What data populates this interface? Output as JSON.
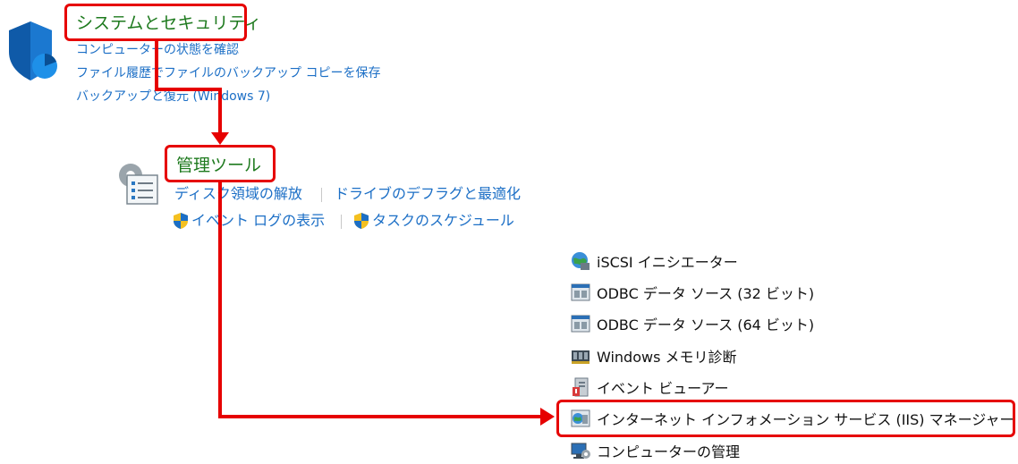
{
  "system_security": {
    "heading": "システムとセキュリティ",
    "links": [
      "コンピューターの状態を確認",
      "ファイル履歴でファイルのバックアップ コピーを保存",
      "バックアップと復元 (Windows 7)"
    ]
  },
  "admin_tools": {
    "heading": "管理ツール",
    "row1": [
      "ディスク領域の解放",
      "ドライブのデフラグと最適化"
    ],
    "row2": [
      "イベント ログの表示",
      "タスクのスケジュール"
    ]
  },
  "tool_list": [
    {
      "label": "iSCSI イニシエーター",
      "icon": "globe-icon"
    },
    {
      "label": "ODBC データ ソース (32 ビット)",
      "icon": "odbc-icon"
    },
    {
      "label": "ODBC データ ソース (64 ビット)",
      "icon": "odbc-icon"
    },
    {
      "label": "Windows メモリ診断",
      "icon": "memory-chip-icon"
    },
    {
      "label": "イベント ビューアー",
      "icon": "event-viewer-icon"
    },
    {
      "label": "インターネット インフォメーション サービス (IIS) マネージャー",
      "icon": "iis-icon"
    },
    {
      "label": "コンピューターの管理",
      "icon": "computer-management-icon"
    }
  ],
  "colors": {
    "accent_red": "#e60000",
    "heading_green": "#1e7a1e",
    "link_blue": "#1c6fc6"
  }
}
